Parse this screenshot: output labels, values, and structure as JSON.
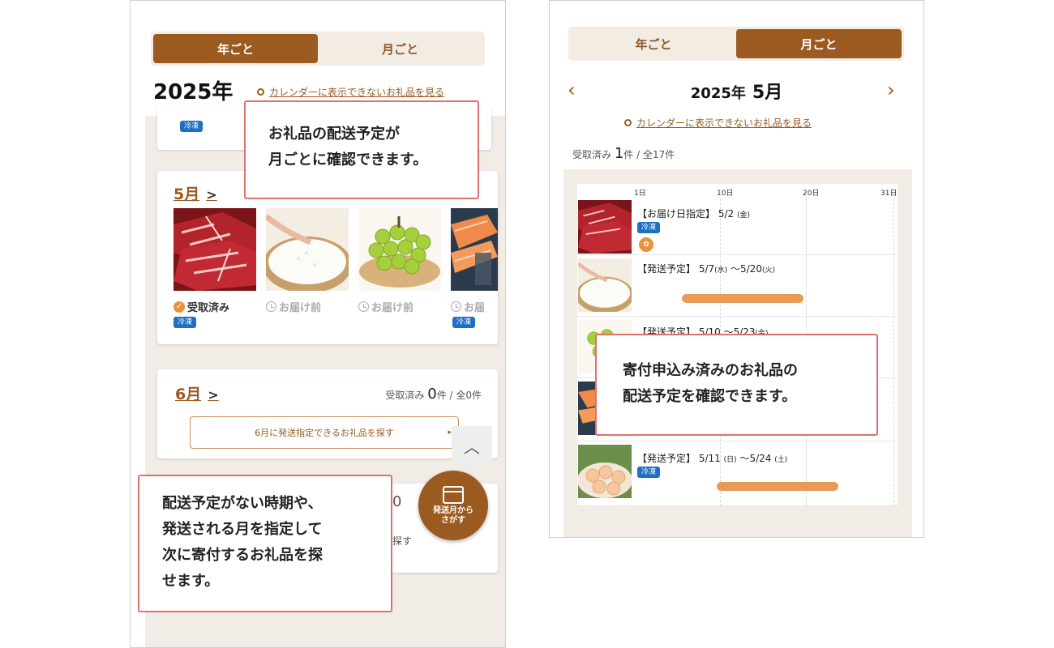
{
  "left": {
    "tabs": {
      "year": "年ごと",
      "month": "月ごと"
    },
    "year_title": "2025年",
    "calendar_link": "カレンダーに表示できないお礼品を見る",
    "prev_badge": "冷凍",
    "may": {
      "month_label": "5月",
      "items": [
        {
          "status": "受取済み",
          "badge": "冷凍"
        },
        {
          "status": "お届け前"
        },
        {
          "status": "お届け前"
        },
        {
          "status": "お届",
          "badge": "冷凍"
        }
      ]
    },
    "june": {
      "month_label": "6月",
      "received_label": "受取済み",
      "received_count": "0",
      "total_label": "件 / 全0件",
      "search_button": "6月に発送指定できるお礼品を探す"
    },
    "fab_label_1": "発送月から",
    "fab_label_2": "さがす",
    "peek_count": "0",
    "peek_text": "探す",
    "callout_top": [
      "お礼品の配送予定が",
      "月ごとに確認できます。"
    ],
    "callout_bottom": [
      "配送予定がない時期や、",
      "発送される月を指定して",
      "次に寄付するお礼品を探",
      "せます。"
    ]
  },
  "right": {
    "tabs": {
      "year": "年ごと",
      "month": "月ごと"
    },
    "year": "2025年",
    "month": "5月",
    "calendar_link": "カレンダーに表示できないお礼品を見る",
    "received_label": "受取済み",
    "received_count": "1",
    "total_label": "件 / 全17件",
    "axis": [
      "1日",
      "10日",
      "20日",
      "31日"
    ],
    "rows": [
      {
        "label": "【お届け日指定】 5/2",
        "day": "(金)",
        "badge": "冷凍"
      },
      {
        "label": "【発送予定】 5/7",
        "day": "(水)",
        "label2": "～5/20",
        "day2": "(火)"
      },
      {
        "label": "【発送予定】 5/10",
        "label2": "～5/23",
        "day2": "(金)"
      },
      {
        "label": "【発送予定】 5/11",
        "day": "(日)",
        "label2": "～5/24",
        "day2": "(土)",
        "badge": "冷凍"
      }
    ],
    "callout": [
      "寄付申込み済みのお礼品の",
      "配送予定を確認できます。"
    ]
  },
  "colors": {
    "brand": "#9a5a20",
    "accent_bar": "#e89a56",
    "callout_border": "#e07070",
    "badge": "#1f6fc5"
  }
}
